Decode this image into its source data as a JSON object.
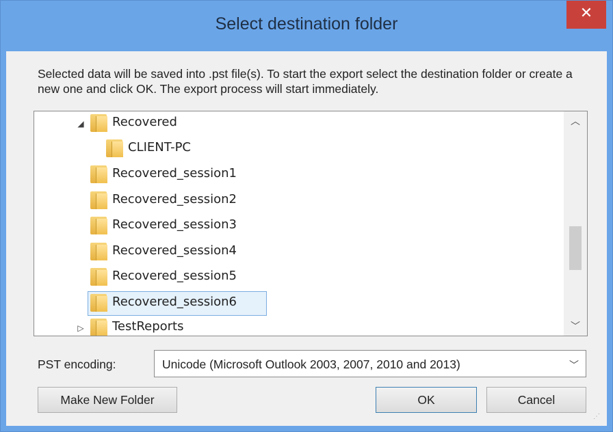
{
  "window": {
    "title": "Select destination folder",
    "close_glyph": "✕"
  },
  "description": "Selected data will be saved into .pst file(s). To start the export select the destination folder or create a new one and click OK. The export process will start immediately.",
  "tree": {
    "items": [
      {
        "label": "Recovered",
        "level": 1,
        "expander": "◢",
        "selected": false
      },
      {
        "label": "CLIENT-PC",
        "level": 2,
        "expander": "",
        "selected": false
      },
      {
        "label": "Recovered_session1",
        "level": 1,
        "expander": "",
        "selected": false
      },
      {
        "label": "Recovered_session2",
        "level": 1,
        "expander": "",
        "selected": false
      },
      {
        "label": "Recovered_session3",
        "level": 1,
        "expander": "",
        "selected": false
      },
      {
        "label": "Recovered_session4",
        "level": 1,
        "expander": "",
        "selected": false
      },
      {
        "label": "Recovered_session5",
        "level": 1,
        "expander": "",
        "selected": false
      },
      {
        "label": "Recovered_session6",
        "level": 1,
        "expander": "",
        "selected": true
      },
      {
        "label": "TestReports",
        "level": 1,
        "expander": "▷",
        "selected": false
      }
    ],
    "scroll_up_glyph": "︿",
    "scroll_down_glyph": "﹀",
    "folder_icon": "folder-icon",
    "folder_color": "#f1c04f",
    "selection_color": "#e5f1fb"
  },
  "encoding": {
    "label": "PST encoding:",
    "value": "Unicode (Microsoft Outlook 2003, 2007, 2010 and 2013)",
    "arrow": "﹀"
  },
  "buttons": {
    "make_new_folder": "Make New Folder",
    "ok": "OK",
    "cancel": "Cancel"
  },
  "resize_grip": "⋰",
  "colors": {
    "titlebar": "#6aa5e8",
    "close": "#c9413b",
    "accent": "#3c7fb1"
  }
}
